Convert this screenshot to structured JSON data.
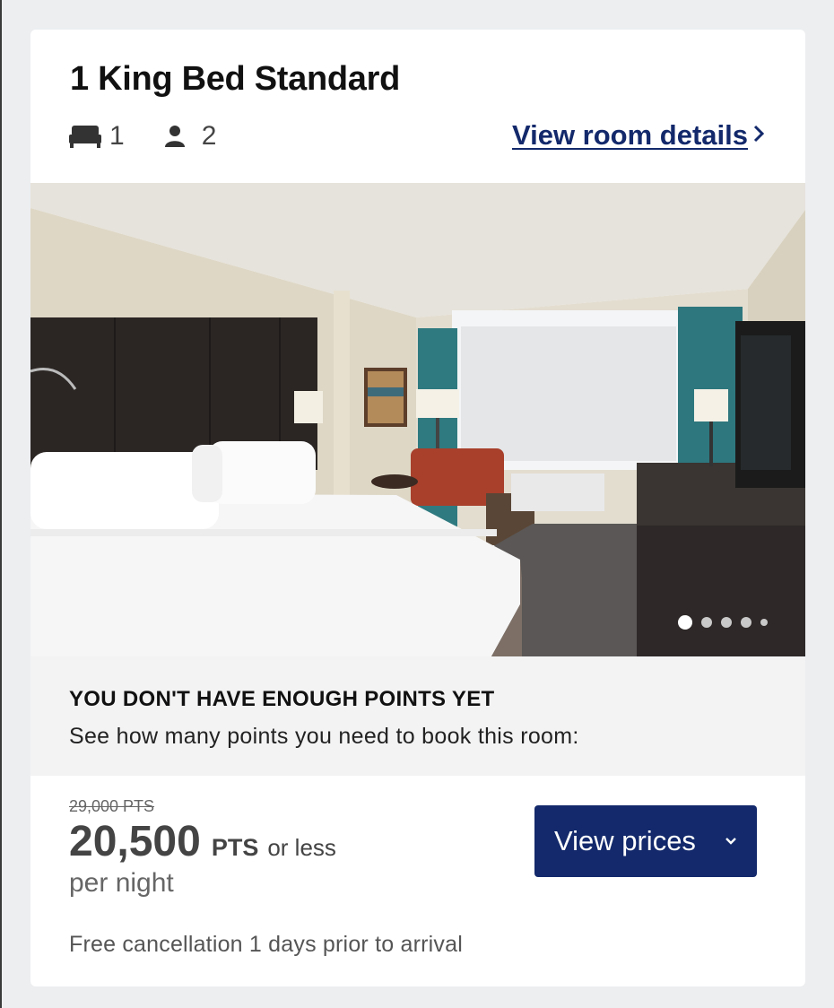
{
  "room": {
    "title": "1 King Bed Standard",
    "beds": "1",
    "guests": "2",
    "details_link": "View room details",
    "icons": {
      "bed": "bed-icon",
      "guests": "person-icon",
      "link_chevron": "chevron-right-icon"
    }
  },
  "gallery": {
    "image_count": 5,
    "active_index": 0
  },
  "notice": {
    "heading": "YOU DON'T HAVE ENOUGH POINTS YET",
    "body": "See how many points you need to book this room:"
  },
  "pricing": {
    "original": "29,000 PTS",
    "value": "20,500",
    "unit": "PTS",
    "suffix": "or less",
    "per": "per night",
    "cancellation": "Free cancellation 1 days prior to arrival",
    "button_label": "View prices",
    "button_icon": "chevron-down-icon"
  },
  "colors": {
    "brand_navy": "#13296b",
    "card_bg": "#ffffff",
    "page_bg": "#eceef0",
    "notice_bg": "#f3f3f4"
  }
}
